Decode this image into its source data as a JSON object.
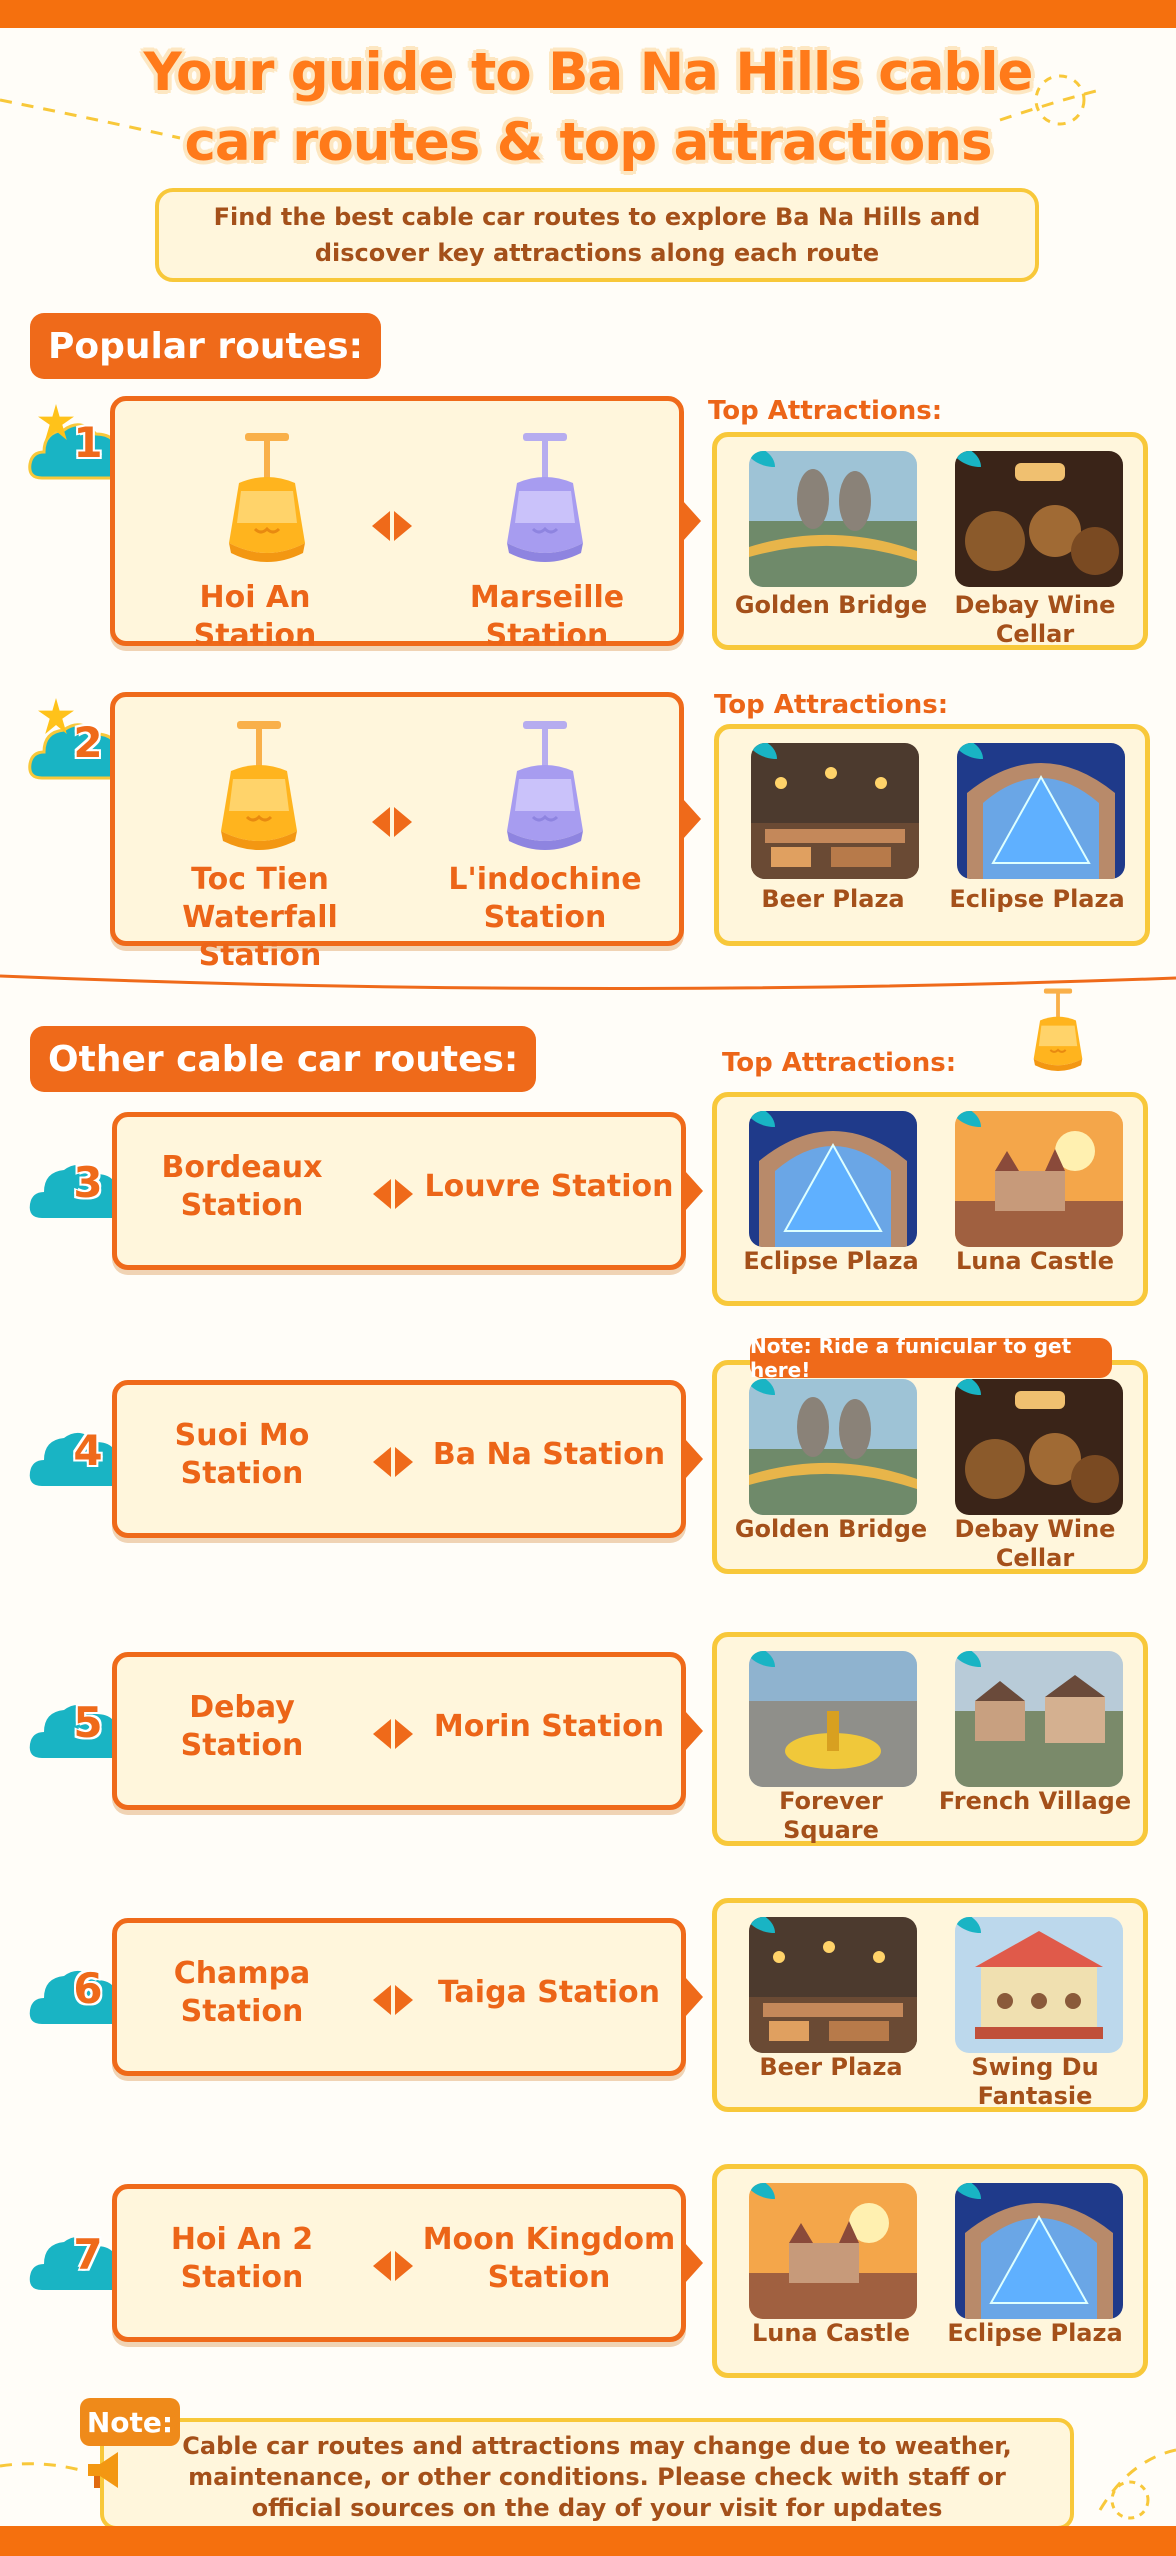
{
  "title_line1": "Your guide to Ba Na Hills cable",
  "title_line2": "car routes & top attractions",
  "subtitle": "Find the best cable car routes to explore Ba Na Hills and discover key attractions along each route",
  "popular_heading": "Popular routes:",
  "other_heading": "Other cable car routes:",
  "top_attractions_label": "Top Attractions:",
  "funicular_note": "Note: Ride a funicular to get here!",
  "footer_note_tag": "Note:",
  "footer_note": "Cable car routes and attractions may change due to weather, maintenance, or other conditions. Please check with staff or official sources on the day of your visit for updates",
  "colors": {
    "orange": "#ef6a1a",
    "yellow": "#f8c83a",
    "cream": "#fff6dc",
    "teal": "#19b4c4"
  },
  "routes": [
    {
      "num": "1",
      "from": "Hoi An Station",
      "to": "Marseille Station",
      "a1": "Golden Bridge",
      "a2": "Debay Wine Cellar"
    },
    {
      "num": "2",
      "from": "Toc Tien Waterfall Station",
      "to": "L'indochine Station",
      "a1": "Beer Plaza",
      "a2": "Eclipse Plaza"
    },
    {
      "num": "3",
      "from": "Bordeaux Station",
      "to": "Louvre Station",
      "a1": "Eclipse Plaza",
      "a2": "Luna Castle"
    },
    {
      "num": "4",
      "from": "Suoi Mo Station",
      "to": "Ba Na Station",
      "a1": "Golden Bridge",
      "a2": "Debay Wine Cellar"
    },
    {
      "num": "5",
      "from": "Debay Station",
      "to": "Morin Station",
      "a1": "Forever Square",
      "a2": "French Village"
    },
    {
      "num": "6",
      "from": "Champa Station",
      "to": "Taiga Station",
      "a1": "Beer Plaza",
      "a2": "Swing Du Fantasie"
    },
    {
      "num": "7",
      "from": "Hoi An 2 Station",
      "to": "Moon Kingdom Station",
      "a1": "Luna Castle",
      "a2": "Eclipse Plaza"
    }
  ]
}
